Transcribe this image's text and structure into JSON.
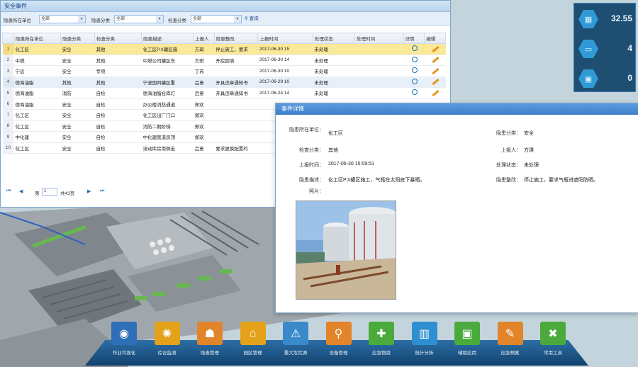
{
  "list_window": {
    "title": "安全事件",
    "filters": [
      {
        "label": "隐患所在单位",
        "value": "全部"
      },
      {
        "label": "隐患分类",
        "value": "全部"
      },
      {
        "label": "检查分类",
        "value": "全部"
      }
    ],
    "query_label": "查询",
    "columns": [
      "",
      "隐患所在单位",
      "隐患分类",
      "检查分类",
      "隐患描述",
      "上报人",
      "隐患整改",
      "上报时间",
      "处理状态",
      "处理时间",
      "详情",
      "编辑"
    ],
    "rows": [
      {
        "n": "1",
        "unit": "化工区",
        "cat": "安全",
        "check": "其他",
        "desc": "化工区P.X罐区施",
        "reporter": "方琪",
        "fix": "停止施工，要求",
        "time": "2017-06-30 15",
        "status": "未处理",
        "done": ""
      },
      {
        "n": "2",
        "unit": "中燃",
        "cat": "安全",
        "check": "其他",
        "desc": "中燃公司罐区东",
        "reporter": "方琪",
        "fix": "开挖回填",
        "time": "2017-06-30 14",
        "status": "未处理",
        "done": ""
      },
      {
        "n": "3",
        "unit": "宁远",
        "cat": "安全",
        "check": "专项",
        "desc": "",
        "reporter": "丁芮",
        "fix": "",
        "time": "2017-06-30 10",
        "status": "未处理",
        "done": ""
      },
      {
        "n": "4",
        "unit": "德海油脂",
        "cat": "其他",
        "check": "其他",
        "desc": "宁波国四罐区重",
        "reporter": "吕意",
        "fix": "开具违章通知书",
        "time": "2017-06-29 10",
        "status": "未处理",
        "done": ""
      },
      {
        "n": "5",
        "unit": "德海油脂",
        "cat": "消防",
        "check": "自检",
        "desc": "德海油脂仓库灯",
        "reporter": "吕意",
        "fix": "开具违章通知书",
        "time": "2017-06-24 14",
        "status": "未处理",
        "done": ""
      },
      {
        "n": "6",
        "unit": "德海油脂",
        "cat": "安全",
        "check": "自检",
        "desc": "办公楼消防通道",
        "reporter": "郑欢",
        "fix": "",
        "time": "",
        "status": "",
        "done": ""
      },
      {
        "n": "7",
        "unit": "化工区",
        "cat": "安全",
        "check": "自检",
        "desc": "化工区出厂门口",
        "reporter": "郑欢",
        "fix": "",
        "time": "",
        "status": "",
        "done": ""
      },
      {
        "n": "8",
        "unit": "化工区",
        "cat": "安全",
        "check": "自检",
        "desc": "消防二期阶梯",
        "reporter": "郑欢",
        "fix": "",
        "time": "",
        "status": "",
        "done": ""
      },
      {
        "n": "9",
        "unit": "中化建",
        "cat": "安全",
        "check": "自检",
        "desc": "中化建管道房顶",
        "reporter": "郑欢",
        "fix": "",
        "time": "",
        "status": "",
        "done": ""
      },
      {
        "n": "10",
        "unit": "化工区",
        "cat": "安全",
        "check": "自检",
        "desc": "流动库房南侧走",
        "reporter": "吕意",
        "fix": "要求更换配置的",
        "time": "",
        "status": "",
        "done": ""
      }
    ],
    "pager": {
      "prefix": "第",
      "page": "1",
      "suffix": "共43页"
    }
  },
  "detail_window": {
    "title": "事件详情",
    "fields": {
      "unit_label": "隐患所在单位：",
      "unit": "化工区",
      "cat_label": "隐患分类：",
      "cat": "安全",
      "check_label": "检查分类：",
      "check": "其他",
      "reporter_label": "上报人：",
      "reporter": "方琪",
      "time_label": "上报时间：",
      "time": "2017-06-30 15:09:51",
      "status_label": "处理状态：",
      "status": "未处理",
      "desc_label": "隐患描述：",
      "desc": "化工区P.X罐区施工，气瓶在太阳底下暴晒。",
      "fix_label": "隐患整改：",
      "fix": "停止施工，要求气瓶进遮阳防晒。",
      "photo_label": "照片："
    }
  },
  "stats": [
    {
      "icon": "building-icon",
      "value": "32.55"
    },
    {
      "icon": "truck-icon",
      "value": "4"
    },
    {
      "icon": "car-icon",
      "value": "0"
    }
  ],
  "toolbar": [
    {
      "label": "作业可视化",
      "icon": "eye-icon",
      "color": "#2f6fb7",
      "glyph": "◉"
    },
    {
      "label": "综合监测",
      "icon": "target-icon",
      "color": "#e3a21a",
      "glyph": "✺"
    },
    {
      "label": "隐患管理",
      "icon": "worker-icon",
      "color": "#e2842a",
      "glyph": "☗"
    },
    {
      "label": "园区管理",
      "icon": "house-icon",
      "color": "#e3a21a",
      "glyph": "⌂"
    },
    {
      "label": "重大危险源",
      "icon": "warning-icon",
      "color": "#3a8ac9",
      "glyph": "⚠"
    },
    {
      "label": "设备管理",
      "icon": "magnifier-icon",
      "color": "#e2842a",
      "glyph": "⚲"
    },
    {
      "label": "应急物资",
      "icon": "medkit-icon",
      "color": "#4aaa3c",
      "glyph": "✚"
    },
    {
      "label": "统计分析",
      "icon": "chart-icon",
      "color": "#2f8fd0",
      "glyph": "▥"
    },
    {
      "label": "辅助应用",
      "icon": "toolbox-icon",
      "color": "#4aaa3c",
      "glyph": "▣"
    },
    {
      "label": "应急预案",
      "icon": "document-icon",
      "color": "#e2842a",
      "glyph": "✎"
    },
    {
      "label": "常用工具",
      "icon": "tools-icon",
      "color": "#4aaa3c",
      "glyph": "✖"
    }
  ]
}
